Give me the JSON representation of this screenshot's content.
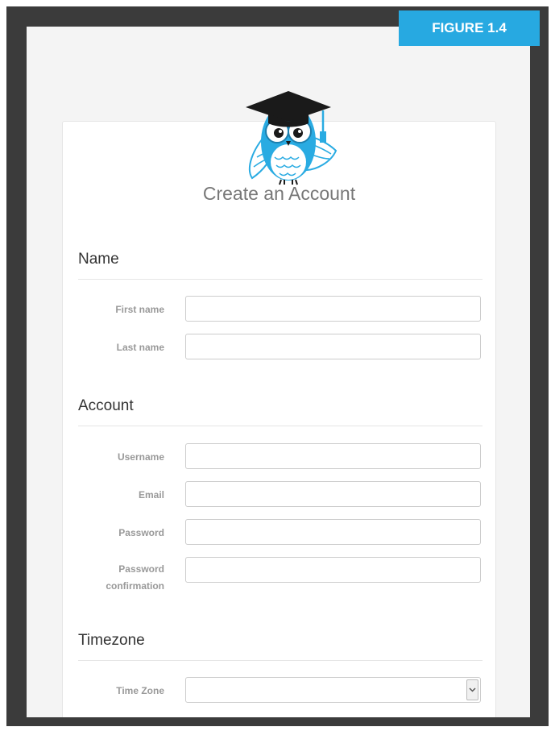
{
  "figure_label": "FIGURE 1.4",
  "card": {
    "title": "Create an Account"
  },
  "sections": {
    "name": {
      "title": "Name",
      "first_name_label": "First name",
      "last_name_label": "Last name"
    },
    "account": {
      "title": "Account",
      "username_label": "Username",
      "email_label": "Email",
      "password_label": "Password",
      "password_confirmation_label_line1": "Password",
      "password_confirmation_label_line2": "confirmation"
    },
    "timezone": {
      "title": "Timezone",
      "time_zone_label": "Time Zone",
      "time_zone_value": ""
    }
  },
  "inputs": {
    "first_name": "",
    "last_name": "",
    "username": "",
    "email": "",
    "password": "",
    "password_confirmation": ""
  },
  "colors": {
    "figure_label_bg": "#27a9e1",
    "owl_blue": "#29abe2",
    "cap": "#1a1a1a"
  },
  "icons": {
    "logo": "owl-graduate-logo",
    "select_arrow": "chevron-down-icon"
  }
}
